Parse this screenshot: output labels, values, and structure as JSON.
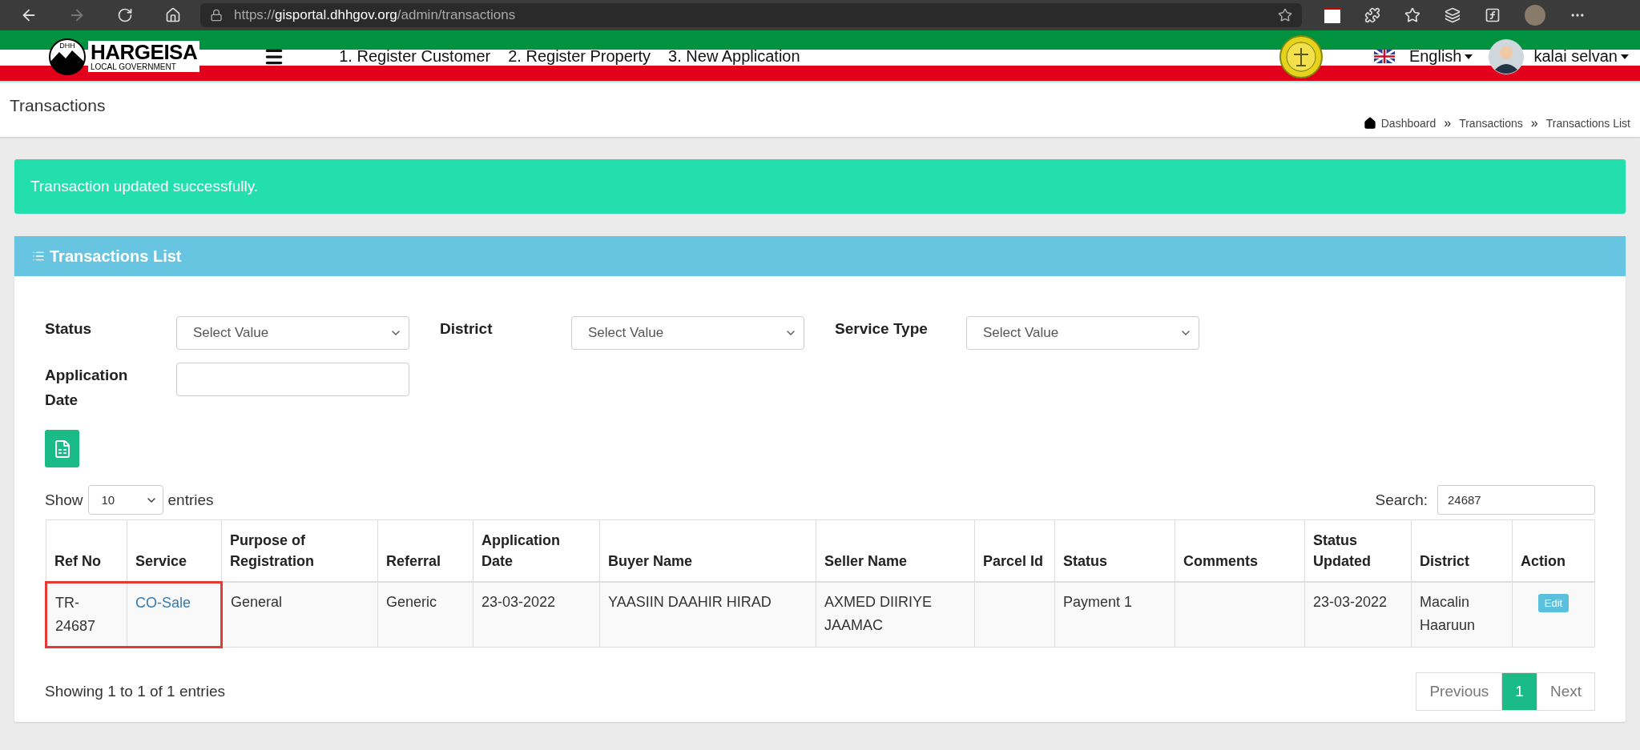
{
  "browser": {
    "url_scheme": "https://",
    "url_host": "gisportal.dhhgov.org",
    "url_path": "/admin/transactions"
  },
  "header": {
    "logo_mark": "DHH",
    "logo_title": "HARGEISA",
    "logo_subtitle": "LOCAL GOVERNMENT",
    "nav": [
      "1. Register Customer",
      "2. Register Property",
      "3. New Application"
    ],
    "language": "English",
    "user": "kalai selvan"
  },
  "page_title": "Transactions",
  "breadcrumbs": [
    {
      "kind": "home",
      "text": "Dashboard"
    },
    {
      "kind": "sep",
      "text": "»"
    },
    {
      "kind": "crumb",
      "text": "Transactions"
    },
    {
      "kind": "sep",
      "text": "»"
    },
    {
      "kind": "crumb",
      "text": "Transactions List"
    }
  ],
  "alert": "Transaction updated successfully.",
  "card": {
    "title": "Transactions List",
    "filters": [
      {
        "kind": "select",
        "label": "Status",
        "value": "Select Value"
      },
      {
        "kind": "select",
        "label": "District",
        "value": "Select Value"
      },
      {
        "kind": "select",
        "label": "Service Type",
        "value": "Select Value"
      },
      {
        "kind": "text",
        "label": "Application Date"
      }
    ],
    "length": {
      "prefix": "Show",
      "value": "10",
      "suffix": "entries"
    },
    "search": {
      "label": "Search:",
      "value": "24687"
    },
    "table": {
      "columns": [
        "Ref No",
        "Service",
        "Purpose of Registration",
        "Referral",
        "Application Date",
        "Buyer Name",
        "Seller Name",
        "Parcel Id",
        "Status",
        "Comments",
        "Status Updated",
        "District",
        "Action"
      ],
      "rows": [
        {
          "highlighted": true,
          "cells": [
            {
              "kind": "text",
              "text": "TR-24687"
            },
            {
              "kind": "link",
              "text": "CO-Sale"
            },
            {
              "kind": "text",
              "text": "General"
            },
            {
              "kind": "text",
              "text": "Generic"
            },
            {
              "kind": "text",
              "text": "23-03-2022"
            },
            {
              "kind": "text",
              "text": "YAASIIN DAAHIR HIRAD"
            },
            {
              "kind": "text",
              "text": "AXMED DIIRIYE JAAMAC"
            },
            {
              "kind": "empty"
            },
            {
              "kind": "text",
              "text": "Payment 1"
            },
            {
              "kind": "empty"
            },
            {
              "kind": "text",
              "text": "23-03-2022"
            },
            {
              "kind": "text",
              "text": "Macalin Haaruun"
            },
            {
              "kind": "button",
              "text": "Edit"
            }
          ]
        }
      ]
    },
    "info": "Showing 1 to 1 of 1 entries",
    "pagination": [
      {
        "label": "Previous",
        "selected": false
      },
      {
        "label": "1",
        "selected": true
      },
      {
        "label": "Next",
        "selected": false
      }
    ]
  }
}
